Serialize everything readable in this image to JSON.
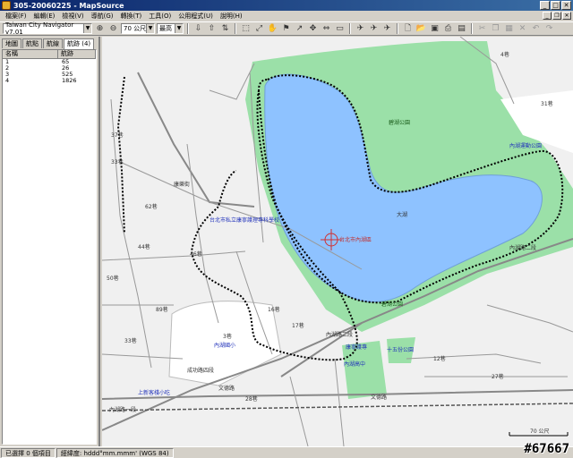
{
  "window": {
    "title": "305-20060225 - MapSource"
  },
  "menu": [
    "檔案(F)",
    "編輯(E)",
    "檢視(V)",
    "導航(G)",
    "轉換(T)",
    "工具(O)",
    "公用程式(U)",
    "說明(H)"
  ],
  "toolbar": {
    "map_product": "Taiwan City Navigator v7.01",
    "zoom": "70 公尺",
    "detail": "最高"
  },
  "left_panel": {
    "tabs": [
      "地圖",
      "航點",
      "航線",
      "航跡 (4)"
    ],
    "active_tab": 3,
    "columns": {
      "name": "名稱",
      "distance": "航跡"
    },
    "rows": [
      {
        "name": "1",
        "distance": "65"
      },
      {
        "name": "2",
        "distance": "26"
      },
      {
        "name": "3",
        "distance": "525"
      },
      {
        "name": "4",
        "distance": "1826"
      }
    ]
  },
  "map": {
    "lake": "大湖",
    "park_east": "碧湖公園",
    "park_south": "碧湖公園",
    "roads": [
      "內湖路二段",
      "內湖路二段",
      "文德路",
      "文德路",
      "成功路四段",
      "內湖路一段",
      "康樂街"
    ],
    "lanes": [
      "62巷",
      "37巷",
      "33巷",
      "46巷",
      "44巷",
      "50巷",
      "89巷",
      "16巷",
      "17巷",
      "33巷",
      "12巷",
      "27巷",
      "4巷",
      "31巷",
      "28巷",
      "3巷"
    ],
    "pois": [
      "台北市內湖區",
      "內湖國小",
      "康寧護專",
      "台北市私立康寧護理專科學校",
      "內湖高中",
      "十五份公園",
      "上新客棧小吃",
      "內湖運動公園"
    ],
    "cursor_label": "台北市內湖區",
    "scale": "70 公尺"
  },
  "status": {
    "selected": "已選擇 0 個項目",
    "format": "經緯度: hddd°mm.mmm' (WGS 84)"
  },
  "watermark": "#67667",
  "colors": {
    "lake": "#8ec2ff",
    "park": "#9be0a8",
    "track": "#000000",
    "road": "#888888"
  }
}
